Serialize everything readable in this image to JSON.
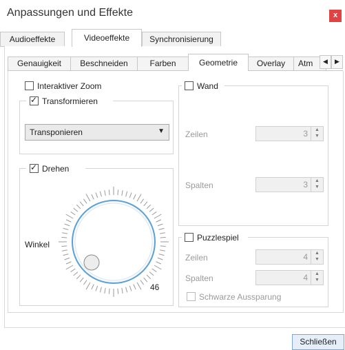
{
  "window": {
    "title": "Anpassungen und Effekte",
    "close_glyph": "x"
  },
  "outer_tabs": [
    "Audioeffekte",
    "Videoeffekte",
    "Synchronisierung"
  ],
  "inner_tabs": [
    "Genauigkeit",
    "Beschneiden",
    "Farben",
    "Geometrie",
    "Overlay",
    "Atm"
  ],
  "inner_scroll": {
    "left": "◀",
    "right": "▶"
  },
  "geometry": {
    "interactive_zoom": {
      "label": "Interaktiver Zoom",
      "checked": false
    },
    "transform": {
      "label": "Transformieren",
      "checked": true,
      "mode": "Transponieren"
    },
    "rotate": {
      "label": "Drehen",
      "checked": true,
      "angle_label": "Winkel",
      "angle_value": "46"
    },
    "wall": {
      "label": "Wand",
      "checked": false,
      "rows_label": "Zeilen",
      "rows_value": "3",
      "cols_label": "Spalten",
      "cols_value": "3"
    },
    "puzzle": {
      "label": "Puzzlespiel",
      "checked": false,
      "rows_label": "Zeilen",
      "rows_value": "4",
      "cols_label": "Spalten",
      "cols_value": "4",
      "black_slot_label": "Schwarze Aussparung",
      "black_slot_checked": false
    }
  },
  "footer": {
    "close_label": "Schließen"
  },
  "colors": {
    "accent": "#4a90d9",
    "close_red": "#e04343"
  }
}
